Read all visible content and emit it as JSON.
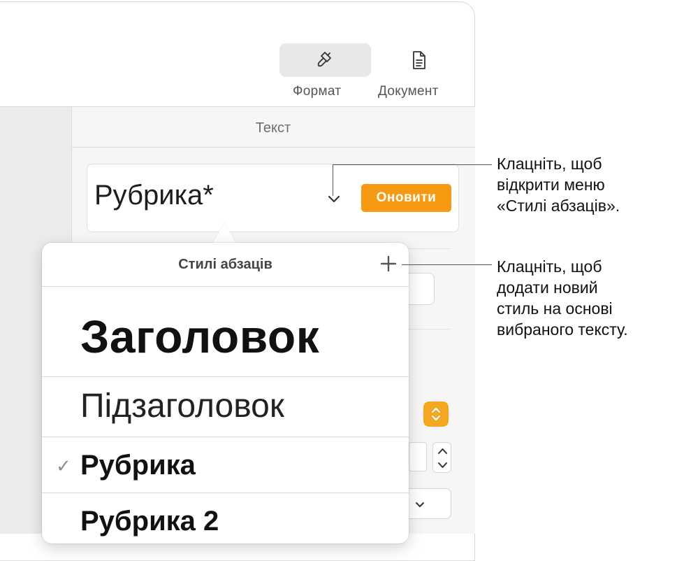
{
  "toolbar": {
    "format_label": "Формат",
    "document_label": "Документ",
    "format_icon": "paintbrush-icon",
    "document_icon": "document-icon"
  },
  "sidebar": {
    "section_title": "Текст",
    "current_style": "Рубрика*",
    "update_button": "Оновити",
    "accent_color": "#f79a11"
  },
  "popover": {
    "title": "Стилі абзаців",
    "items": [
      {
        "label": "Заголовок",
        "selected": false
      },
      {
        "label": "Підзаголовок",
        "selected": false
      },
      {
        "label": "Рубрика",
        "selected": true
      },
      {
        "label": "Рубрика 2",
        "selected": false
      }
    ],
    "check_mark": "✓"
  },
  "callouts": {
    "menu": "Клацніть, щоб\nвідкрити меню\n«Стилі абзаців».",
    "add": "Клацніть, щоб\nдодати новий\nстиль на основі\nвибраного тексту."
  }
}
